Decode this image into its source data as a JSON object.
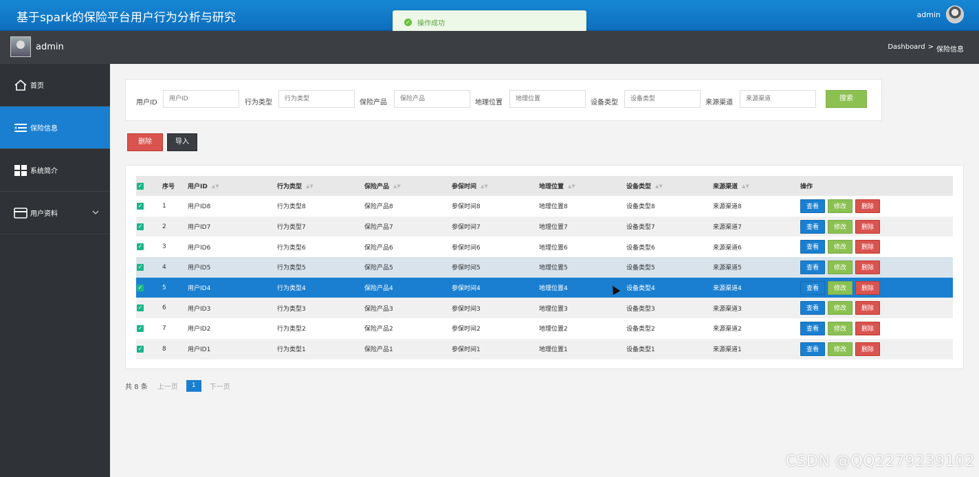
{
  "app": {
    "title": "基于spark的保险平台用户行为分析与研究",
    "top_username": "admin"
  },
  "toast": {
    "message": "操作成功"
  },
  "subheader": {
    "username": "admin",
    "breadcrumb_root": "Dashboard",
    "breadcrumb_sep": ">",
    "breadcrumb_current": "保险信息"
  },
  "sidebar": {
    "items": [
      {
        "label": "首页",
        "icon": "home-icon"
      },
      {
        "label": "保险信息",
        "icon": "list-icon",
        "active": true
      },
      {
        "label": "系统简介",
        "icon": "grid-icon"
      },
      {
        "label": "用户资料",
        "icon": "card-icon",
        "caret": "chevron-down-icon"
      }
    ]
  },
  "search": {
    "fields": [
      {
        "label": "用户ID",
        "placeholder": "用户ID"
      },
      {
        "label": "行为类型",
        "placeholder": "行为类型"
      },
      {
        "label": "保险产品",
        "placeholder": "保险产品"
      },
      {
        "label": "地理位置",
        "placeholder": "地理位置"
      },
      {
        "label": "设备类型",
        "placeholder": "设备类型"
      },
      {
        "label": "来源渠道",
        "placeholder": "来源渠道"
      }
    ],
    "button_label": "搜索"
  },
  "toolbar": {
    "delete_label": "删除",
    "import_label": "导入"
  },
  "table": {
    "columns": [
      "序号",
      "用户ID",
      "行为类型",
      "保险产品",
      "参保时间",
      "地理位置",
      "设备类型",
      "来源渠道",
      "操作"
    ],
    "action_labels": {
      "view": "查看",
      "edit": "修改",
      "delete": "删除"
    },
    "rows": [
      {
        "no": "1",
        "user_id": "用户ID8",
        "behavior": "行为类型8",
        "product": "保险产品8",
        "time": "参保时间8",
        "location": "地理位置8",
        "device": "设备类型8",
        "channel": "来源渠道8"
      },
      {
        "no": "2",
        "user_id": "用户ID7",
        "behavior": "行为类型7",
        "product": "保险产品7",
        "time": "参保时间7",
        "location": "地理位置7",
        "device": "设备类型7",
        "channel": "来源渠道7"
      },
      {
        "no": "3",
        "user_id": "用户ID6",
        "behavior": "行为类型6",
        "product": "保险产品6",
        "time": "参保时间6",
        "location": "地理位置6",
        "device": "设备类型6",
        "channel": "来源渠道6"
      },
      {
        "no": "4",
        "user_id": "用户ID5",
        "behavior": "行为类型5",
        "product": "保险产品5",
        "time": "参保时间5",
        "location": "地理位置5",
        "device": "设备类型5",
        "channel": "来源渠道5"
      },
      {
        "no": "5",
        "user_id": "用户ID4",
        "behavior": "行为类型4",
        "product": "保险产品4",
        "time": "参保时间4",
        "location": "地理位置4",
        "device": "设备类型4",
        "channel": "来源渠道4"
      },
      {
        "no": "6",
        "user_id": "用户ID3",
        "behavior": "行为类型3",
        "product": "保险产品3",
        "time": "参保时间3",
        "location": "地理位置3",
        "device": "设备类型3",
        "channel": "来源渠道3"
      },
      {
        "no": "7",
        "user_id": "用户ID2",
        "behavior": "行为类型2",
        "product": "保险产品2",
        "time": "参保时间2",
        "location": "地理位置2",
        "device": "设备类型2",
        "channel": "来源渠道2"
      },
      {
        "no": "8",
        "user_id": "用户ID1",
        "behavior": "行为类型1",
        "product": "保险产品1",
        "time": "参保时间1",
        "location": "地理位置1",
        "device": "设备类型1",
        "channel": "来源渠道1"
      }
    ]
  },
  "pagination": {
    "total_text": "共 8 条",
    "prev_label": "上一页",
    "current_page": "1",
    "next_label": "下一页"
  },
  "watermark": "CSDN @QQ2279239102",
  "colors": {
    "primary": "#1a7fd0",
    "success": "#8cc152",
    "danger": "#d9534f",
    "dark": "#3a3d41",
    "checkbox": "#1bb58a"
  }
}
